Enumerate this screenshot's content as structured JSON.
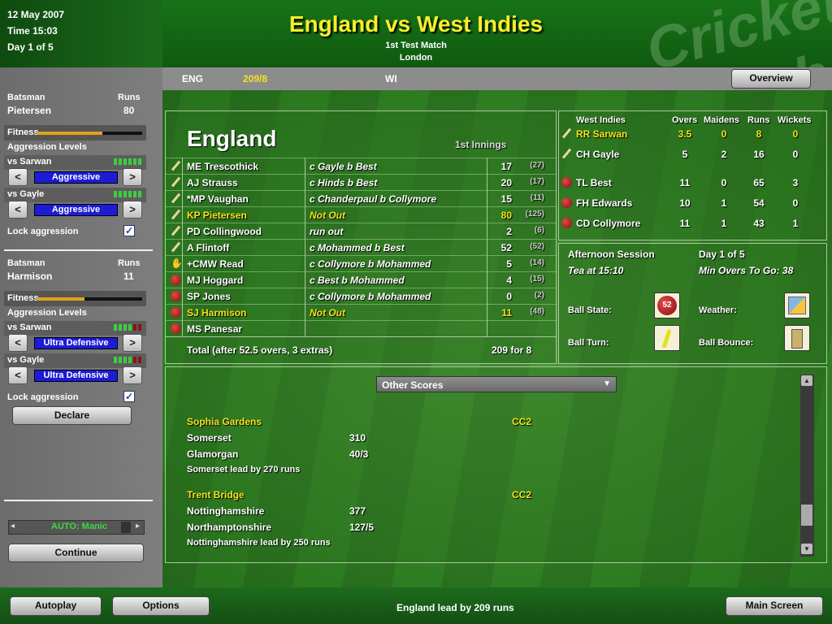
{
  "header": {
    "date": "12 May 2007",
    "time": "Time 15:03",
    "day": "Day 1 of 5",
    "title": "England vs West Indies",
    "subtitle1": "1st Test Match",
    "subtitle2": "London",
    "watermark": "Cricket coach"
  },
  "strip": {
    "team1": "ENG",
    "team1_score": "209/8",
    "team2": "WI",
    "overview_button": "Overview"
  },
  "batsman1": {
    "lbl_batsman": "Batsman",
    "lbl_runs": "Runs",
    "name": "Pietersen",
    "runs": "80",
    "fitness_label": "Fitness",
    "fitness": 0.62,
    "aggr_label": "Aggression Levels",
    "vs1_label": "vs Sarwan",
    "vs1_value": "Aggressive",
    "vs2_label": "vs Gayle",
    "vs2_value": "Aggressive",
    "lock_label": "Lock aggression",
    "lock_checked": "✓"
  },
  "batsman2": {
    "lbl_batsman": "Batsman",
    "lbl_runs": "Runs",
    "name": "Harmison",
    "runs": "11",
    "fitness_label": "Fitness",
    "fitness": 0.45,
    "aggr_label": "Aggression Levels",
    "vs1_label": "vs Sarwan",
    "vs1_value": "Ultra Defensive",
    "vs2_label": "vs Gayle",
    "vs2_value": "Ultra Defensive",
    "lock_label": "Lock aggression",
    "lock_checked": "✓"
  },
  "sidebar": {
    "declare": "Declare",
    "auto_label": "AUTO: Manic",
    "continue": "Continue",
    "arrow_left": "<",
    "arrow_right": ">",
    "small_left": "◂",
    "small_right": "▸"
  },
  "scorecard": {
    "team": "England",
    "innings": "1st Innings",
    "rows": [
      {
        "name": "ME Trescothick",
        "how": "c Gayle b Best",
        "runs": "17",
        "balls": "(27)",
        "icon": "bat"
      },
      {
        "name": "AJ Strauss",
        "how": "c Hinds b Best",
        "runs": "20",
        "balls": "(17)",
        "icon": "bat"
      },
      {
        "name": "*MP Vaughan",
        "how": "c Chanderpaul b Collymore",
        "runs": "15",
        "balls": "(11)",
        "icon": "bat"
      },
      {
        "name": "KP Pietersen",
        "how": "Not Out",
        "runs": "80",
        "balls": "(125)",
        "icon": "bat",
        "hl": true
      },
      {
        "name": "PD Collingwood",
        "how": "run out",
        "runs": "2",
        "balls": "(6)",
        "icon": "bat"
      },
      {
        "name": "A Flintoff",
        "how": "c Mohammed b Best",
        "runs": "52",
        "balls": "(52)",
        "icon": "bat"
      },
      {
        "name": "+CMW Read",
        "how": "c Collymore b Mohammed",
        "runs": "5",
        "balls": "(14)",
        "icon": "glove"
      },
      {
        "name": "MJ Hoggard",
        "how": "c Best b Mohammed",
        "runs": "4",
        "balls": "(15)",
        "icon": "ball"
      },
      {
        "name": "SP Jones",
        "how": "c Collymore b Mohammed",
        "runs": "0",
        "balls": "(2)",
        "icon": "ball"
      },
      {
        "name": "SJ Harmison",
        "how": "Not Out",
        "runs": "11",
        "balls": "(48)",
        "icon": "ball",
        "hl": true
      },
      {
        "name": "MS Panesar",
        "how": "",
        "runs": "",
        "balls": "",
        "icon": "ball"
      }
    ],
    "total_label": "Total (after 52.5 overs, 3 extras)",
    "total": "209 for 8"
  },
  "bowling": {
    "team": "West Indies",
    "h_overs": "Overs",
    "h_maidens": "Maidens",
    "h_runs": "Runs",
    "h_wickets": "Wickets",
    "rows": [
      {
        "name": "RR Sarwan",
        "overs": "3.5",
        "maidens": "0",
        "runs": "8",
        "wickets": "0",
        "icon": "bat",
        "hl": true
      },
      {
        "name": "CH Gayle",
        "overs": "5",
        "maidens": "2",
        "runs": "16",
        "wickets": "0",
        "icon": "bat"
      },
      {
        "name": "TL Best",
        "overs": "11",
        "maidens": "0",
        "runs": "65",
        "wickets": "3",
        "icon": "ball"
      },
      {
        "name": "FH Edwards",
        "overs": "10",
        "maidens": "1",
        "runs": "54",
        "wickets": "0",
        "icon": "ball"
      },
      {
        "name": "CD Collymore",
        "overs": "11",
        "maidens": "1",
        "runs": "43",
        "wickets": "1",
        "icon": "ball"
      }
    ]
  },
  "session": {
    "name": "Afternoon Session",
    "day": "Day 1 of 5",
    "tea": "Tea at 15:10",
    "min_overs": "Min Overs To Go: 38",
    "ball_state_lbl": "Ball State:",
    "ball_state_val": "52",
    "weather_lbl": "Weather:",
    "ball_turn_lbl": "Ball Turn:",
    "ball_bounce_lbl": "Ball Bounce:"
  },
  "other_scores": {
    "dropdown": "Other Scores",
    "matches": [
      {
        "venue": "Sophia Gardens",
        "comp": "CC2",
        "team1": "Somerset",
        "score1": "310",
        "team2": "Glamorgan",
        "score2": "40/3",
        "summary": "Somerset lead by 270 runs"
      },
      {
        "venue": "Trent Bridge",
        "comp": "CC2",
        "team1": "Nottinghamshire",
        "score1": "377",
        "team2": "Northamptonshire",
        "score2": "127/5",
        "summary": "Nottinghamshire lead by 250 runs"
      }
    ]
  },
  "footer": {
    "autoplay": "Autoplay",
    "options": "Options",
    "status": "England lead by 209 runs",
    "main_screen": "Main Screen"
  }
}
